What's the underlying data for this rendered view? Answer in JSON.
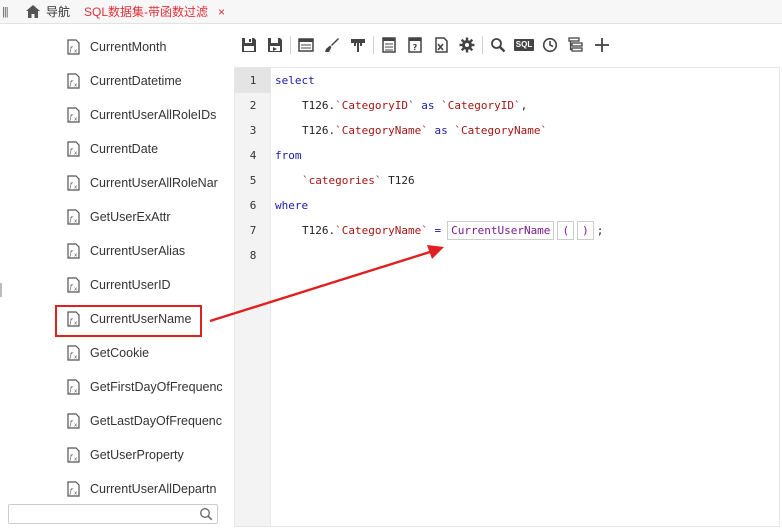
{
  "topbar": {
    "menu_icon": "menu-icon",
    "home_icon": "home-icon",
    "nav_label": "导航",
    "tab_title": "SQL数据集-带函数过滤",
    "tab_close": "×"
  },
  "sidebar": {
    "functions": [
      {
        "label": "CurrentMonth"
      },
      {
        "label": "CurrentDatetime"
      },
      {
        "label": "CurrentUserAllRoleIDs"
      },
      {
        "label": "CurrentDate"
      },
      {
        "label": "CurrentUserAllRoleNar"
      },
      {
        "label": "GetUserExAttr"
      },
      {
        "label": "CurrentUserAlias"
      },
      {
        "label": "CurrentUserID"
      },
      {
        "label": "CurrentUserName"
      },
      {
        "label": "GetCookie"
      },
      {
        "label": "GetFirstDayOfFrequenc"
      },
      {
        "label": "GetLastDayOfFrequenc"
      },
      {
        "label": "GetUserProperty"
      },
      {
        "label": "CurrentUserAllDepartn"
      }
    ],
    "highlighted": "CurrentUserName",
    "search": {
      "value": "",
      "placeholder": ""
    }
  },
  "toolbar": {
    "buttons": [
      "save-icon",
      "save-as-icon",
      "layout-icon",
      "brush-icon",
      "format-icon",
      "table-icon",
      "query-icon",
      "excel-icon",
      "gear-icon",
      "search-icon",
      "sql-icon",
      "clock-icon",
      "tree-icon",
      "plus-icon"
    ],
    "sql_label": "SQL"
  },
  "editor": {
    "line_numbers": [
      "1",
      "2",
      "3",
      "4",
      "5",
      "6",
      "7",
      "8"
    ],
    "l1_kw": "select",
    "l2_a": "T126.",
    "l2_b": "`CategoryID`",
    "l2_c": "as",
    "l2_d": "`CategoryID`",
    "l2_e": ",",
    "l3_a": "T126.",
    "l3_b": "`CategoryName`",
    "l3_c": "as",
    "l3_d": "`CategoryName`",
    "l4_kw": "from",
    "l5_a": "`categories`",
    "l5_b": "T126",
    "l6_kw": "where",
    "l7_a": "T126.",
    "l7_b": "`CategoryName`",
    "l7_c": "=",
    "l7_fn": "CurrentUserName",
    "l7_open": "(",
    "l7_close": ")",
    "l7_semi": ";"
  },
  "colors": {
    "accent": "#e0303a",
    "keyword": "#1a1aa6",
    "string": "#a31515",
    "function": "#7a1a8c",
    "annotation": "#e02020"
  }
}
